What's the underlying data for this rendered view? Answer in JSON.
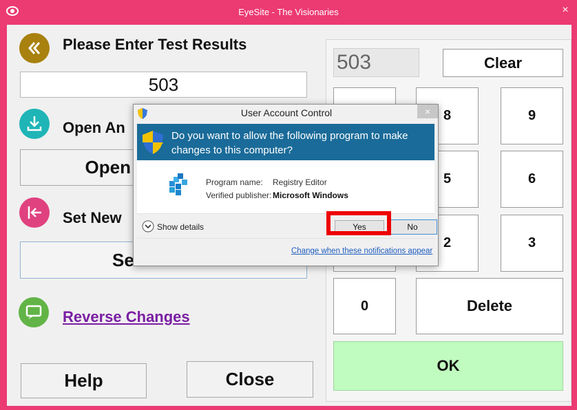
{
  "window": {
    "title": "EyeSite - The Visionaries",
    "close_glyph": "×"
  },
  "left": {
    "enter_heading": "Please Enter Test Results",
    "result_value": "503",
    "open_heading": "Open An",
    "open_button": "Open",
    "set_heading": "Set New",
    "set_button": "Se",
    "reverse_link": "Reverse Changes",
    "help_button": "Help",
    "close_button": "Close"
  },
  "keypad": {
    "display": "503",
    "clear": "Clear",
    "keys": {
      "k8": "8",
      "k9": "9",
      "k5": "5",
      "k6": "6",
      "k2": "2",
      "k3": "3",
      "k0": "0"
    },
    "delete": "Delete",
    "ok": "OK"
  },
  "uac": {
    "title": "User Account Control",
    "question": "Do you want to allow the following program to make changes to this computer?",
    "program_label": "Program name:",
    "program_value": "Registry Editor",
    "publisher_label": "Verified publisher:",
    "publisher_value": "Microsoft Windows",
    "show_details": "Show details",
    "yes": "Yes",
    "no": "No",
    "notif_link": "Change when these notifications appear",
    "close_glyph": "×"
  },
  "colors": {
    "frame": "#ec3a73",
    "ok_green": "#c0fbbf",
    "uac_banner": "#1a6b99",
    "highlight": "#ee0000",
    "icon_gold": "#a8810f",
    "icon_teal": "#1fb5b7",
    "icon_pink": "#e0427f",
    "icon_green": "#62b447",
    "link_purple": "#7a1ea3"
  },
  "icons": [
    "back-chevrons-icon",
    "download-icon",
    "arrow-left-bar-icon",
    "chat-back-icon",
    "uac-shield-icon",
    "registry-editor-icon",
    "expand-chevron-icon"
  ]
}
